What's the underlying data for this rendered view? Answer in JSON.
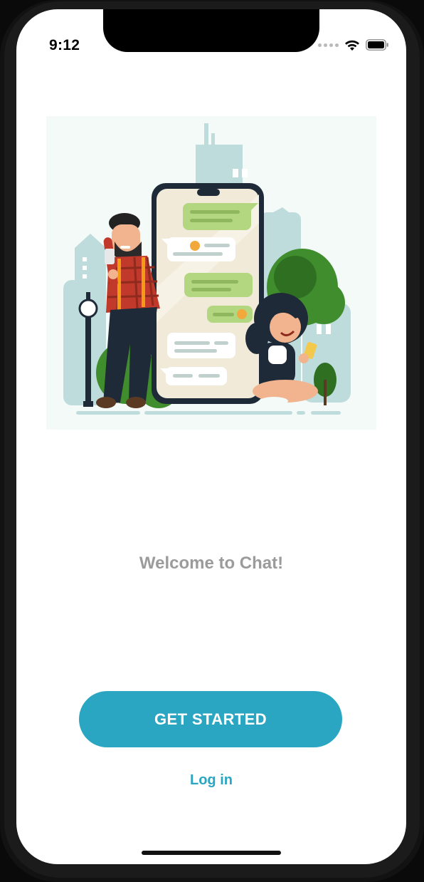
{
  "status_bar": {
    "time": "9:12",
    "icons": [
      "signal-dots-icon",
      "wifi-icon",
      "battery-icon"
    ]
  },
  "hero": {
    "illustration": "two-people-chatting-illustration"
  },
  "welcome": {
    "title": "Welcome to Chat!"
  },
  "actions": {
    "get_started_label": "GET STARTED",
    "login_label": "Log in"
  },
  "colors": {
    "accent": "#2aa6c2",
    "title_gray": "#9b9b9b",
    "bubble_green": "#b3d681"
  }
}
